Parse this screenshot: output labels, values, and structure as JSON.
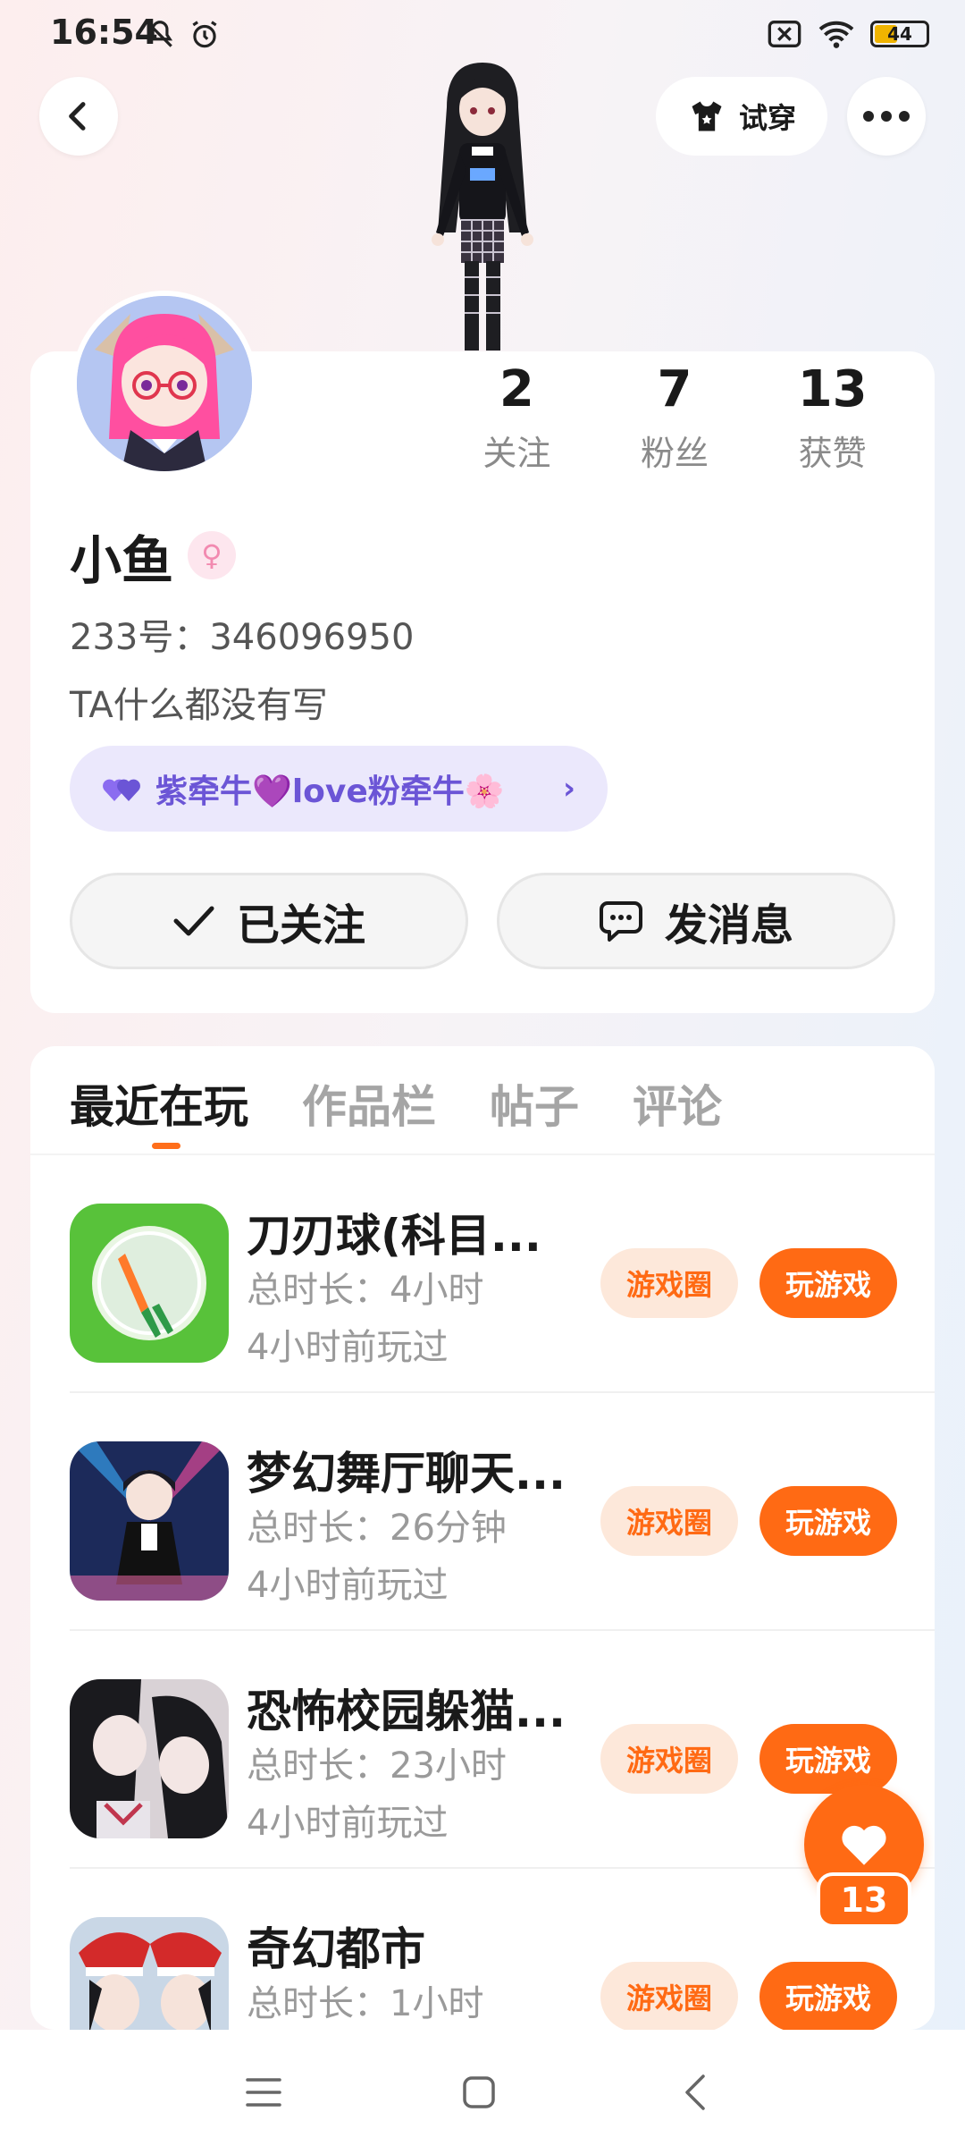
{
  "status_bar": {
    "time": "16:54",
    "battery": "44",
    "icons_left": [
      "mute-icon",
      "alarm-icon"
    ],
    "icons_right": [
      "sim-off-icon",
      "wifi-icon",
      "battery-icon"
    ]
  },
  "header": {
    "tryon_label": "试穿"
  },
  "profile": {
    "stats": [
      {
        "value": "2",
        "label": "关注"
      },
      {
        "value": "7",
        "label": "粉丝"
      },
      {
        "value": "13",
        "label": "获赞"
      }
    ],
    "name": "小鱼",
    "gender_symbol": "♀",
    "uid": "233号：346096950",
    "bio": "TA什么都没有写",
    "tag": "紫牵牛💜love粉牵牛🌸",
    "follow_label": "已关注",
    "message_label": "发消息"
  },
  "tabs": [
    "最近在玩",
    "作品栏",
    "帖子",
    "评论"
  ],
  "games": [
    {
      "name": "刀刃球(科目...",
      "duration": "总时长：4小时",
      "last_played": "4小时前玩过",
      "circle_label": "游戏圈",
      "play_label": "玩游戏"
    },
    {
      "name": "梦幻舞厅聊天...",
      "duration": "总时长：26分钟",
      "last_played": "4小时前玩过",
      "circle_label": "游戏圈",
      "play_label": "玩游戏"
    },
    {
      "name": "恐怖校园躲猫...",
      "duration": "总时长：23小时",
      "last_played": "4小时前玩过",
      "circle_label": "游戏圈",
      "play_label": "玩游戏"
    },
    {
      "name": "奇幻都市",
      "duration": "总时长：1小时",
      "last_played": "",
      "circle_label": "游戏圈",
      "play_label": "玩游戏"
    }
  ],
  "like_fab": {
    "count": "13"
  },
  "colors": {
    "accent": "#ff6a14",
    "tag_bg": "#ebe8fc",
    "tag_text": "#6b55d6"
  }
}
